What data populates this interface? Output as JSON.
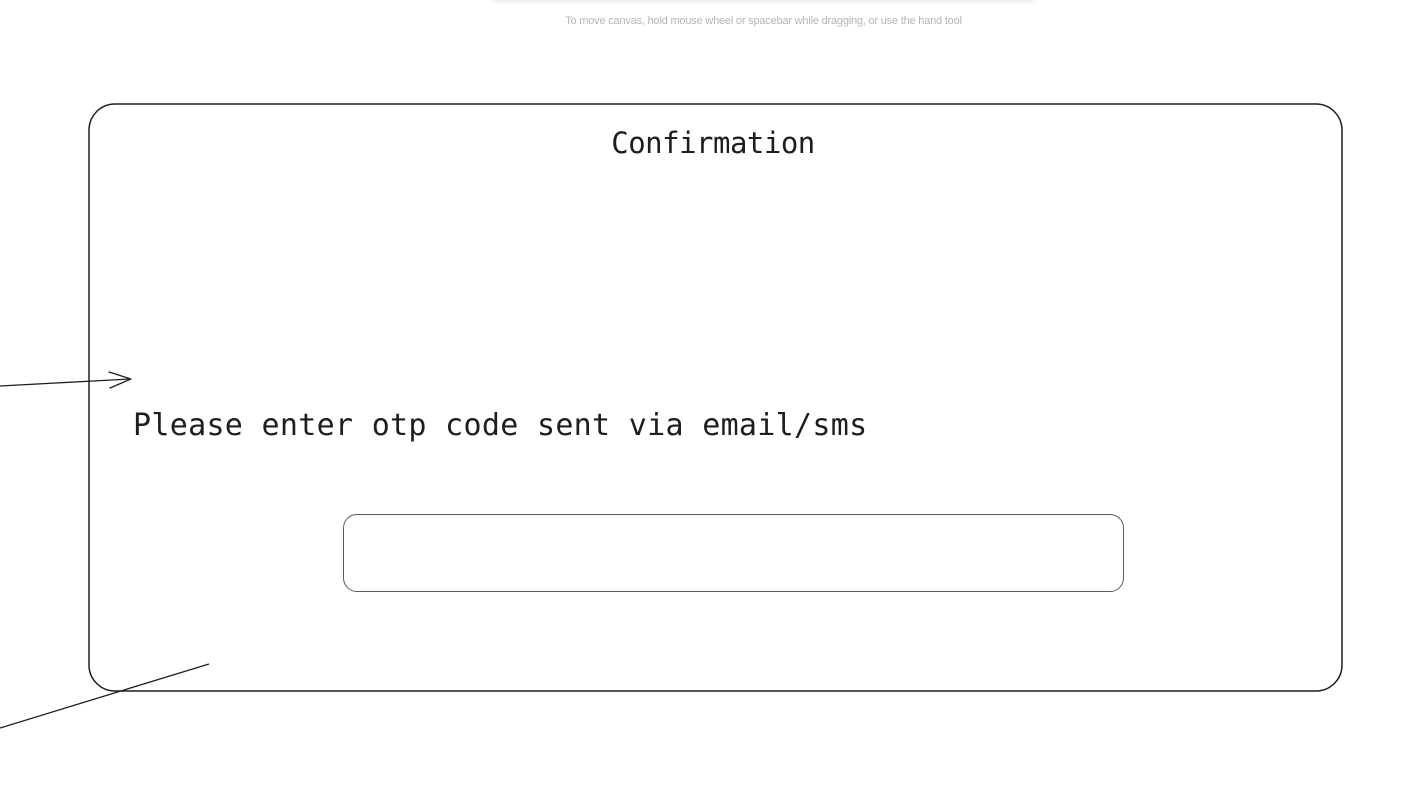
{
  "canvas": {
    "hint": "To move canvas, hold mouse wheel or spacebar while dragging, or use the hand tool"
  },
  "frame": {
    "title": "Confirmation",
    "instruction": "Please enter otp code sent via email/sms",
    "otp_value": "",
    "otp_placeholder": ""
  },
  "colors": {
    "stroke": "#1e1e1e",
    "input_stroke": "#5c5c5c",
    "hint_text": "#b5b5b5"
  }
}
